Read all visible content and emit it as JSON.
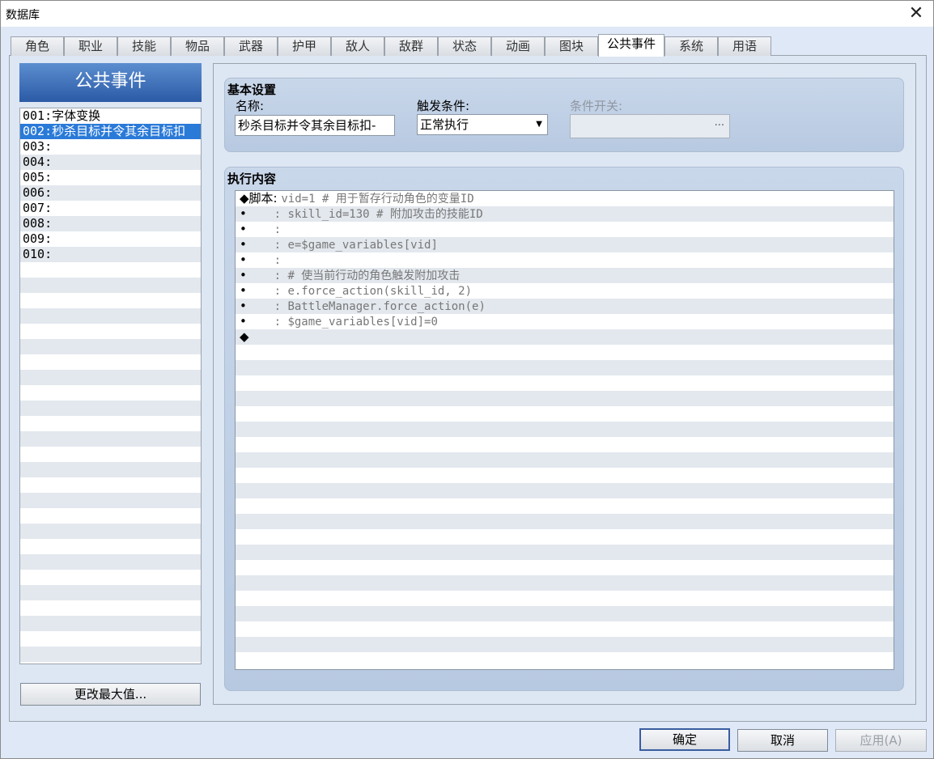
{
  "window": {
    "title": "数据库",
    "close_symbol": "✕"
  },
  "tabs": [
    "角色",
    "职业",
    "技能",
    "物品",
    "武器",
    "护甲",
    "敌人",
    "敌群",
    "状态",
    "动画",
    "图块",
    "公共事件",
    "系统",
    "用语"
  ],
  "active_tab": "公共事件",
  "event_list": {
    "header": "公共事件",
    "items": [
      {
        "id": "001:",
        "name": "字体变换"
      },
      {
        "id": "002:",
        "name": "秒杀目标并令其余目标扣"
      },
      {
        "id": "003:",
        "name": ""
      },
      {
        "id": "004:",
        "name": ""
      },
      {
        "id": "005:",
        "name": ""
      },
      {
        "id": "006:",
        "name": ""
      },
      {
        "id": "007:",
        "name": ""
      },
      {
        "id": "008:",
        "name": ""
      },
      {
        "id": "009:",
        "name": ""
      },
      {
        "id": "010:",
        "name": ""
      }
    ],
    "selected_index": 1,
    "change_max_button": "更改最大值..."
  },
  "basic_settings": {
    "title": "基本设置",
    "name_label": "名称:",
    "name_value": "秒杀目标并令其余目标扣-",
    "trigger_label": "触发条件:",
    "trigger_value": "正常执行",
    "switch_label": "条件开关:",
    "switch_value": "",
    "switch_button": "..."
  },
  "contents": {
    "title": "执行内容",
    "lines": [
      {
        "mark": "◆",
        "prefix": "脚本: ",
        "code": "vid=1 # 用于暂存行动角色的变量ID"
      },
      {
        "mark": "•",
        "prefix": "    : ",
        "code": "skill_id=130 # 附加攻击的技能ID"
      },
      {
        "mark": "•",
        "prefix": "    : ",
        "code": ""
      },
      {
        "mark": "•",
        "prefix": "    : ",
        "code": "e=$game_variables[vid]"
      },
      {
        "mark": "•",
        "prefix": "    : ",
        "code": ""
      },
      {
        "mark": "•",
        "prefix": "    : ",
        "code": "# 使当前行动的角色触发附加攻击"
      },
      {
        "mark": "•",
        "prefix": "    : ",
        "code": "e.force_action(skill_id, 2)"
      },
      {
        "mark": "•",
        "prefix": "    : ",
        "code": "BattleManager.force_action(e)"
      },
      {
        "mark": "•",
        "prefix": "    : ",
        "code": "$game_variables[vid]=0"
      },
      {
        "mark": "◆",
        "prefix": "",
        "code": ""
      }
    ]
  },
  "buttons": {
    "ok": "确定",
    "cancel": "取消",
    "apply": "应用(A)"
  }
}
